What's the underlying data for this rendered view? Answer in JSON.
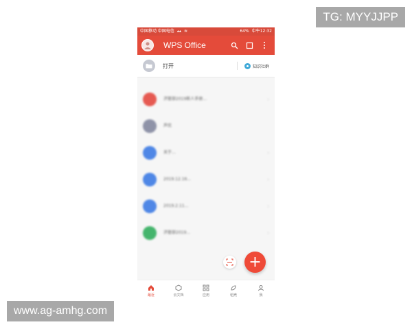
{
  "overlays": {
    "tg": "TG: MYYJJPP",
    "site": "www.ag-amhg.com"
  },
  "status_bar": {
    "carrier": "中国移动 中国电信",
    "battery": "64%",
    "time": "中午12:32"
  },
  "header": {
    "title": "WPS Office"
  },
  "open_row": {
    "label": "打开",
    "community": "知识社群"
  },
  "documents": [
    {
      "title": "济管部2019新人手册...",
      "subtitle": "",
      "meta": "",
      "icon_color": "#e65a52"
    },
    {
      "title": "声优",
      "subtitle": "",
      "meta": "",
      "icon_color": "#8f93a8"
    },
    {
      "title": "关于...",
      "subtitle": "",
      "meta": "",
      "icon_color": "#4f87e6"
    },
    {
      "title": "2019.12.16...",
      "subtitle": "",
      "meta": "",
      "icon_color": "#4f87e6"
    },
    {
      "title": "2019.2.11...",
      "subtitle": "",
      "meta": "",
      "icon_color": "#4f87e6"
    },
    {
      "title": "济管部2019...",
      "subtitle": "",
      "meta": "",
      "icon_color": "#45b56d"
    }
  ],
  "bottom_nav": [
    {
      "label": "最近",
      "icon": "home-icon",
      "active": true
    },
    {
      "label": "云文档",
      "icon": "cloud-doc-icon",
      "active": false
    },
    {
      "label": "应用",
      "icon": "apps-icon",
      "active": false
    },
    {
      "label": "稻壳",
      "icon": "leaf-icon",
      "active": false
    },
    {
      "label": "我",
      "icon": "profile-icon",
      "active": false
    }
  ],
  "accent_colors": {
    "primary_red": "#e44b3a"
  }
}
